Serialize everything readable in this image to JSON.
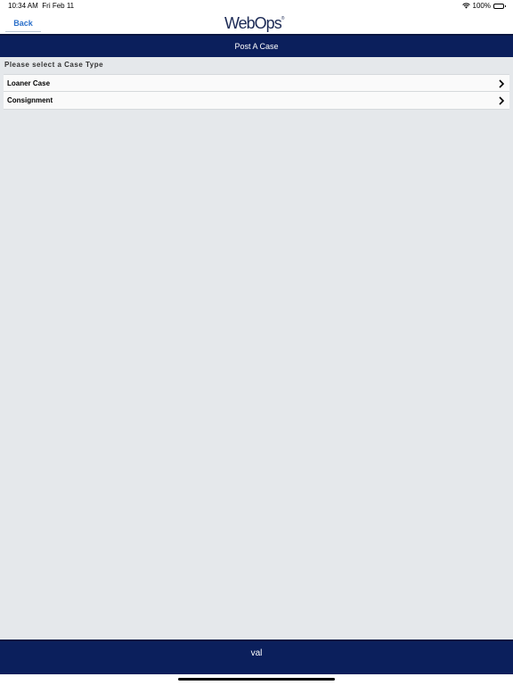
{
  "status_bar": {
    "time": "10:34 AM",
    "date": "Fri Feb 11",
    "battery": "100%"
  },
  "nav": {
    "back_label": "Back",
    "logo_text": "WebOps",
    "logo_mark": "®"
  },
  "title_bar": {
    "title": "Post A Case"
  },
  "section": {
    "header": "Please select a Case Type"
  },
  "case_types": [
    {
      "label": "Loaner Case"
    },
    {
      "label": "Consignment"
    }
  ],
  "footer": {
    "text": "val"
  },
  "colors": {
    "nav_dark": "#0b1f5c",
    "accent_link": "#2a6fc9",
    "background": "#e5e8eb"
  }
}
